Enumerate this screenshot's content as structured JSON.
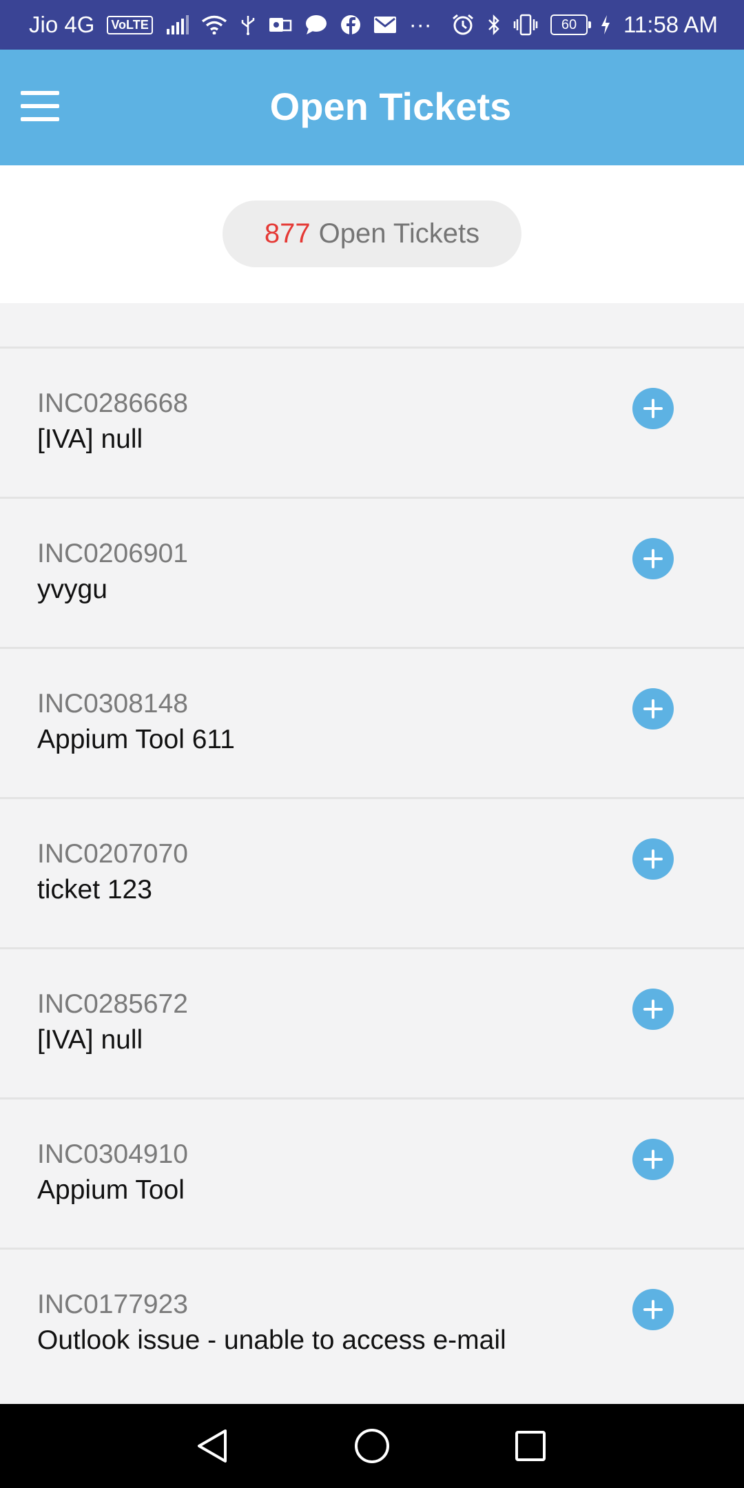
{
  "status_bar": {
    "carrier": "Jio 4G",
    "volte": "VoLTE",
    "more": "···",
    "battery": "60",
    "time": "11:58 AM",
    "icons_left": [
      "signal-icon",
      "wifi-icon",
      "usb-icon",
      "outlook-icon",
      "message-icon",
      "facebook-icon",
      "mail-icon"
    ],
    "icons_right": [
      "alarm-icon",
      "bluetooth-icon",
      "vibrate-icon",
      "battery-icon",
      "charging-icon"
    ]
  },
  "app_bar": {
    "title": "Open Tickets",
    "menu_icon": "hamburger-menu-icon",
    "color": "#5db2e3"
  },
  "summary": {
    "count": "877",
    "label": "Open Tickets",
    "count_color": "#e53935"
  },
  "tickets": [
    {
      "id": "INC0286668",
      "title": "[IVA] null"
    },
    {
      "id": "INC0206901",
      "title": "yvygu"
    },
    {
      "id": "INC0308148",
      "title": "Appium Tool 611"
    },
    {
      "id": "INC0207070",
      "title": "ticket 123"
    },
    {
      "id": "INC0285672",
      "title": "[IVA] null"
    },
    {
      "id": "INC0304910",
      "title": "Appium Tool"
    },
    {
      "id": "INC0177923",
      "title": "Outlook issue - unable to access e-mail"
    }
  ],
  "nav_bar": {
    "buttons": [
      "back-triangle-icon",
      "home-circle-icon",
      "recents-square-icon"
    ]
  }
}
